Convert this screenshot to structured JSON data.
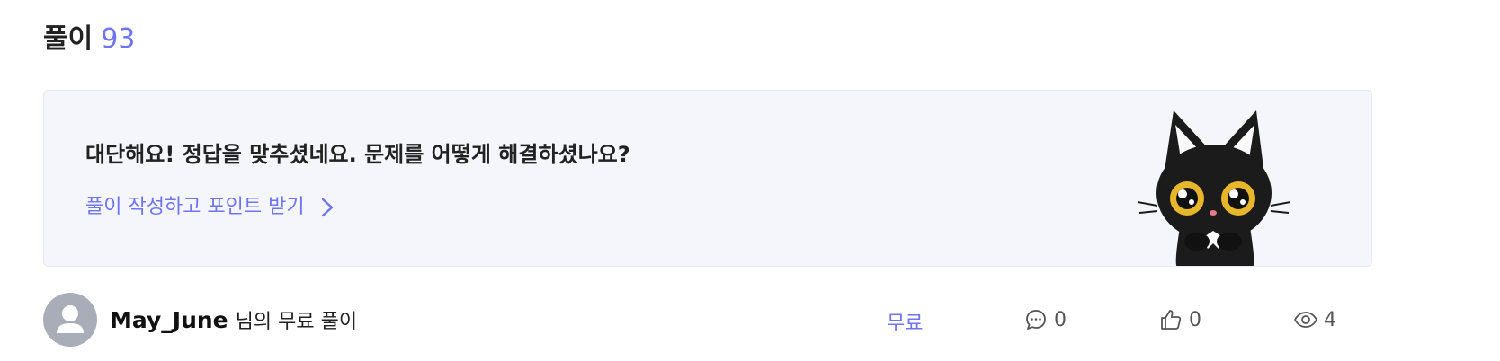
{
  "section": {
    "title": "풀이",
    "count": "93"
  },
  "banner": {
    "message": "대단해요! 정답을 맞추셨네요. 문제를 어떻게 해결하셨나요?",
    "cta_label": "풀이 작성하고 포인트 받기",
    "mascot": "black-cat-illustration"
  },
  "solution": {
    "author": "May_June",
    "author_suffix": "님의 무료 풀이",
    "price_tag": "무료",
    "comments": "0",
    "likes": "0",
    "views": "4"
  },
  "colors": {
    "accent": "#6f74f0",
    "banner_bg": "#f4f6fb",
    "avatar_bg": "#a8adb8"
  }
}
